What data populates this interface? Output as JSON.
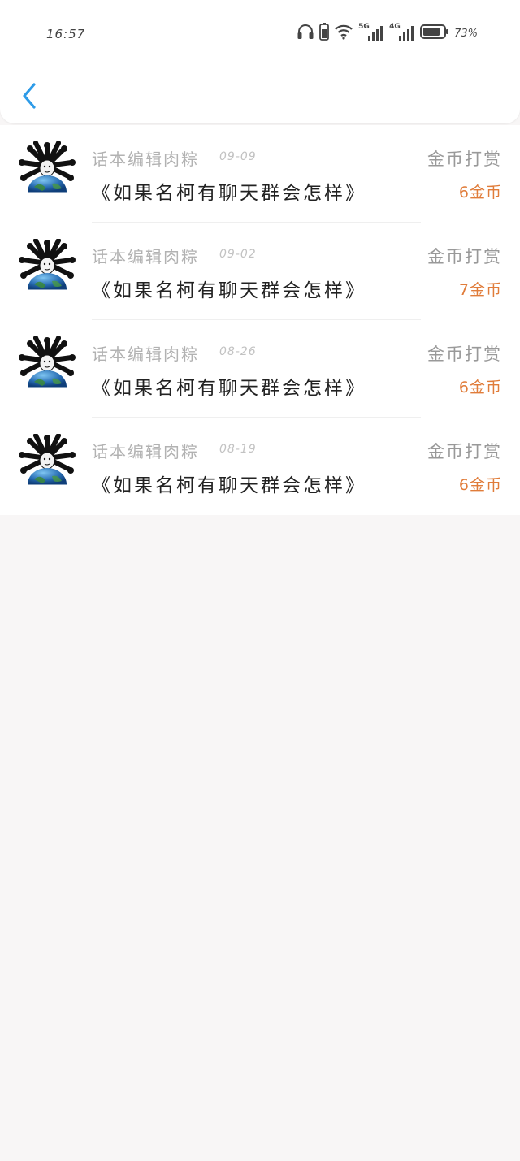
{
  "status_bar": {
    "time": "16:57",
    "battery_percent": "73%",
    "network_5g": "5G",
    "network_4g": "4G",
    "icons": [
      "headphones-icon",
      "battery-small-icon",
      "wifi-icon",
      "signal-5g-icon",
      "signal-4g-icon",
      "battery-icon"
    ]
  },
  "nav": {
    "back_icon": "chevron-left-icon",
    "accent_color": "#2d9be8"
  },
  "tips": [
    {
      "author": "话本编辑肉粽",
      "date": "09-09",
      "title": "《如果名柯有聊天群会怎样》",
      "type": "金币打赏",
      "amount": "6金币"
    },
    {
      "author": "话本编辑肉粽",
      "date": "09-02",
      "title": "《如果名柯有聊天群会怎样》",
      "type": "金币打赏",
      "amount": "7金币"
    },
    {
      "author": "话本编辑肉粽",
      "date": "08-26",
      "title": "《如果名柯有聊天群会怎样》",
      "type": "金币打赏",
      "amount": "6金币"
    },
    {
      "author": "话本编辑肉粽",
      "date": "08-19",
      "title": "《如果名柯有聊天群会怎样》",
      "type": "金币打赏",
      "amount": "6金币"
    }
  ],
  "colors": {
    "amount": "#e07c3a",
    "background": "#f8f6f6"
  }
}
